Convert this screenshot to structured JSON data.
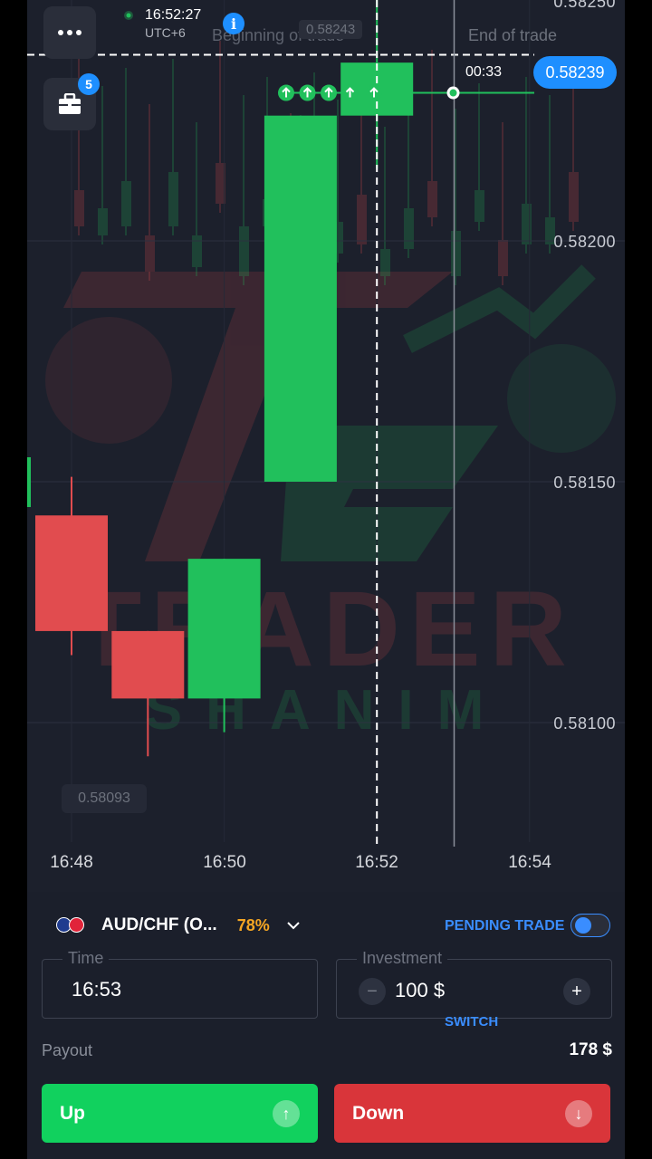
{
  "colors": {
    "bull": "#21c05c",
    "bear": "#e14c4f",
    "accent": "#1e8fff",
    "payout": "#f5a623",
    "up_button": "#11d15e",
    "down_button": "#d9353a"
  },
  "header": {
    "menu_icon": "more-dots-icon",
    "portfolio_icon": "briefcase-icon",
    "portfolio_badge": "5",
    "clock": "16:52:27",
    "timezone": "UTC+6",
    "info_icon": "info-icon",
    "begin_label": "Beginning of trade",
    "begin_price": "0.58243",
    "end_label": "End of trade",
    "countdown": "00:33",
    "current_price": "0.58239"
  },
  "chart": {
    "price_labels": [
      "0.58250",
      "0.58200",
      "0.58150",
      "0.58100"
    ],
    "time_labels": [
      "16:48",
      "16:50",
      "16:52",
      "16:54"
    ],
    "low_marker": "0.58093"
  },
  "chart_data": {
    "type": "candlestick",
    "x": [
      "16:48",
      "16:49",
      "16:50",
      "16:51",
      "16:52"
    ],
    "open": [
      0.58143,
      0.58119,
      0.58105,
      0.5815,
      0.58226
    ],
    "close": [
      0.58119,
      0.58105,
      0.58134,
      0.58226,
      0.58237
    ],
    "high": [
      0.58151,
      0.58119,
      0.58134,
      0.58226,
      0.58252
    ],
    "low": [
      0.58114,
      0.58093,
      0.58098,
      0.5815,
      0.58215
    ],
    "ylim": [
      0.58072,
      0.58258
    ],
    "yticks": [
      0.5825,
      0.582,
      0.5815,
      0.581
    ],
    "xticks": [
      "16:48",
      "16:50",
      "16:52",
      "16:54"
    ],
    "current_price": 0.58239,
    "trade_entry_price": 0.58239,
    "trade_count": 5
  },
  "trade_panel": {
    "asset_flags": [
      "au-flag-icon",
      "ch-flag-icon"
    ],
    "asset": "AUD/CHF (O...",
    "payout_percent": "78%",
    "asset_chevron": "chevron-down-icon",
    "pending_label": "PENDING TRADE",
    "time_label": "Time",
    "time_value": "16:53",
    "investment_label": "Investment",
    "investment_value": "100 $",
    "minus": "−",
    "plus": "+",
    "switch_label": "SWITCH",
    "payout_label": "Payout",
    "payout_value": "178 $",
    "up_label": "Up",
    "down_label": "Down"
  }
}
